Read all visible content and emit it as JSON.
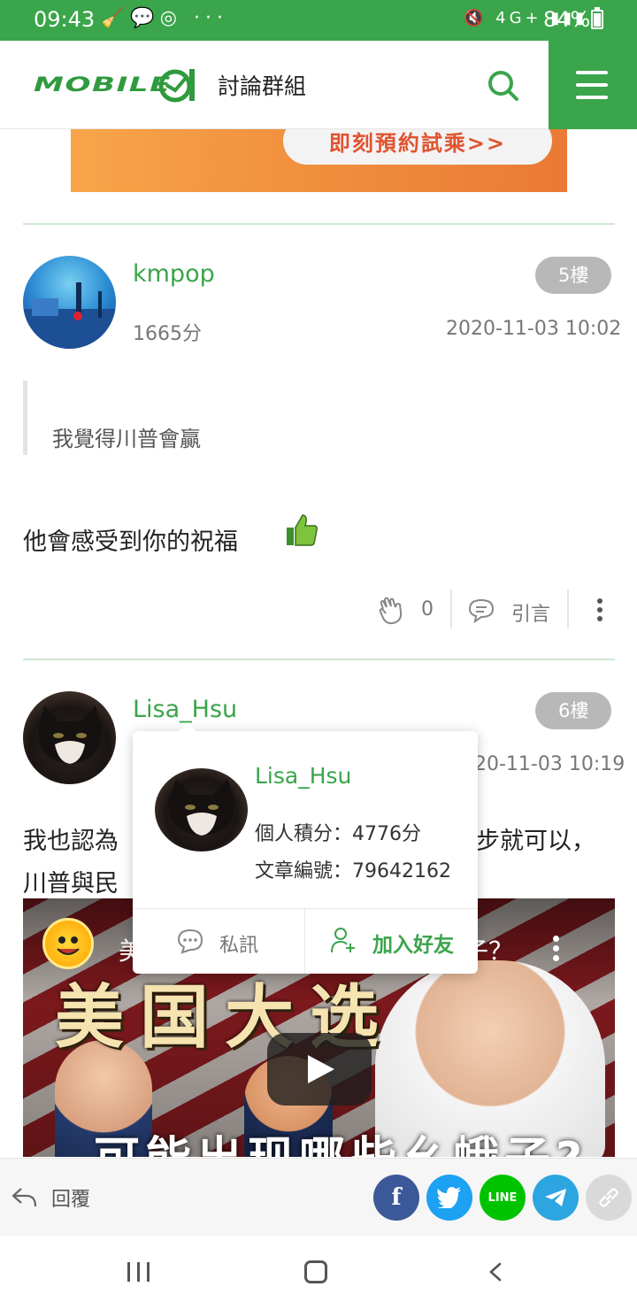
{
  "status_bar": {
    "time": "09:43",
    "left_icons": "🧹💬◎ ···",
    "right_icons": "🔇 4G+ ▮▮▮",
    "battery": "84%"
  },
  "header": {
    "logo_text": "MOBILE",
    "section_title": "討論群組"
  },
  "banner": {
    "cta": "即刻預約試乘>>"
  },
  "posts": [
    {
      "username": "kmpop",
      "score": "1665分",
      "date": "2020-11-03 10:02",
      "floor": "5樓",
      "quote": "我覺得川普會贏",
      "body": "他會感受到你的祝福",
      "claps": "0",
      "quote_label": "引言"
    },
    {
      "username": "Lisa_Hsu",
      "date": "20-11-03 10:19",
      "floor": "6樓",
      "body_line1_start": "我也認為",
      "body_line1_end": "步就可以，",
      "body_line2_start": "川普與民"
    }
  ],
  "video": {
    "title_start": "美",
    "title_end": "子？",
    "big_text": "美国大选",
    "bottom_text": "可能出现哪些幺蛾子?"
  },
  "popup": {
    "name": "Lisa_Hsu",
    "score": "個人積分：4776分",
    "article_id": "文章編號：79642162",
    "pm_label": "私訊",
    "add_friend_label": "加入好友"
  },
  "bottom_bar": {
    "reply_label": "回覆",
    "share": [
      {
        "name": "facebook",
        "label": "f",
        "color": "#3b5998"
      },
      {
        "name": "twitter",
        "label": "🐦",
        "color": "#1da1f2"
      },
      {
        "name": "line",
        "label": "LINE",
        "color": "#00c300"
      },
      {
        "name": "telegram",
        "label": "➤",
        "color": "#2ca5e0"
      },
      {
        "name": "link",
        "label": "🔗",
        "color": "#d9d9d9"
      }
    ]
  },
  "colors": {
    "brand_green": "#3aa54a",
    "floor_badge": "#b8b8b8"
  }
}
